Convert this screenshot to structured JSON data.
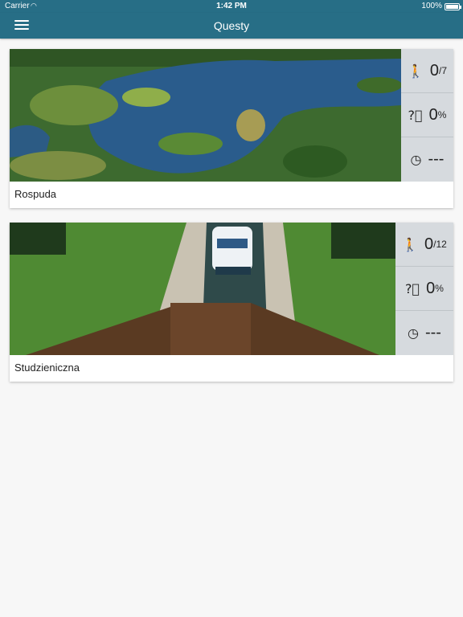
{
  "status_bar": {
    "carrier": "Carrier",
    "time": "1:42 PM",
    "battery": "100%"
  },
  "nav": {
    "title": "Questy",
    "menu_icon": "hamburger-menu-icon"
  },
  "colors": {
    "nav_bg": "#276e86",
    "stats_bg": "#d6dade",
    "page_bg": "#f7f7f7"
  },
  "quests": [
    {
      "name": "Rospuda",
      "image": "aerial-lake-photo",
      "stats": {
        "steps": {
          "icon": "walking-person-icon",
          "value": "0",
          "total": "/7"
        },
        "progress": {
          "icon": "question-circle-icon",
          "value": "0",
          "unit": "%"
        },
        "time": {
          "icon": "clock-icon",
          "value": "---"
        }
      }
    },
    {
      "name": "Studzieniczna",
      "image": "canal-lock-boat-photo",
      "stats": {
        "steps": {
          "icon": "walking-person-icon",
          "value": "0",
          "total": "/12"
        },
        "progress": {
          "icon": "question-circle-icon",
          "value": "0",
          "unit": "%"
        },
        "time": {
          "icon": "clock-icon",
          "value": "---"
        }
      }
    }
  ]
}
